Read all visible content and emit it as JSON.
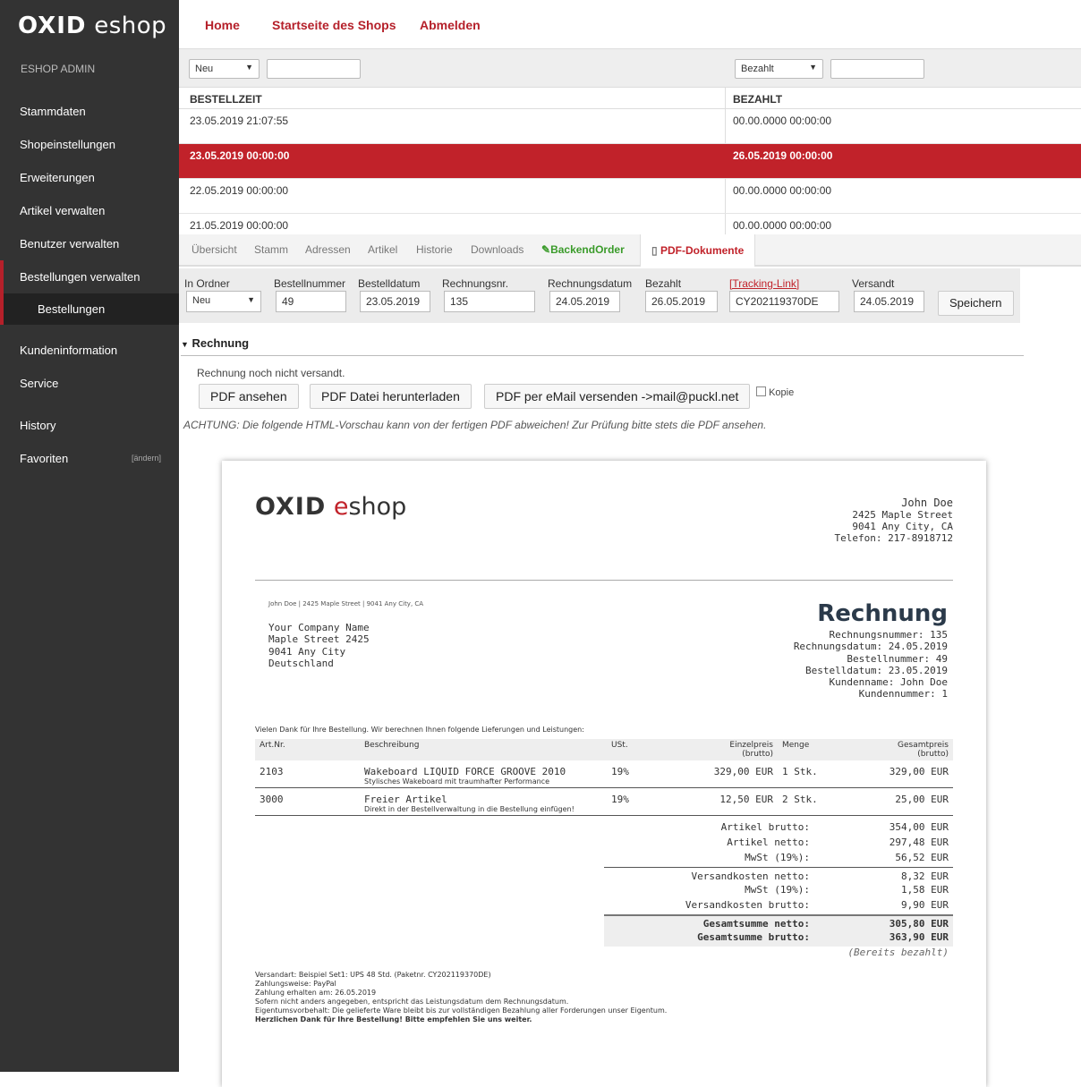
{
  "sidebar": {
    "logo_oxid": "OXID",
    "logo_eshop": "eshop",
    "header": "ESHOP ADMIN",
    "items": [
      "Stammdaten",
      "Shopeinstellungen",
      "Erweiterungen",
      "Artikel verwalten",
      "Benutzer verwalten",
      "Bestellungen verwalten"
    ],
    "sub_item": "Bestellungen",
    "items2": [
      "Kundeninformation",
      "Service"
    ],
    "history": "History",
    "favoriten": "Favoriten",
    "aendern": "[ändern]"
  },
  "topnav": {
    "home": "Home",
    "startseite": "Startseite des Shops",
    "abmelden": "Abmelden"
  },
  "list": {
    "filter_folder": "Neu",
    "filter_paid": "Bezahlt",
    "col_orderdate": "BESTELLZEIT",
    "col_paid": "BEZAHLT",
    "rows": [
      {
        "date": "23.05.2019 21:07:55",
        "paid": "00.00.0000 00:00:00"
      },
      {
        "date": "23.05.2019 00:00:00",
        "paid": "26.05.2019 00:00:00"
      },
      {
        "date": "22.05.2019 00:00:00",
        "paid": "00.00.0000 00:00:00"
      },
      {
        "date": "21.05.2019 00:00:00",
        "paid": "00.00.0000 00:00:00"
      }
    ]
  },
  "tabs": [
    "Übersicht",
    "Stamm",
    "Adressen",
    "Artikel",
    "Historie",
    "Downloads",
    "BackendOrder",
    "PDF-Dokumente"
  ],
  "form": {
    "labels": {
      "folder": "In Ordner",
      "ordernr": "Bestellnummer",
      "orderdate": "Bestelldatum",
      "invnr": "Rechnungsnr.",
      "invdate": "Rechnungsdatum",
      "paid": "Bezahlt",
      "tracking": "[Tracking-Link]",
      "sent": "Versandt"
    },
    "values": {
      "folder": "Neu",
      "ordernr": "49",
      "orderdate": "23.05.2019",
      "invnr": "135",
      "invdate": "24.05.2019",
      "paid": "26.05.2019",
      "tracking": "CY202119370DE",
      "sent": "24.05.2019"
    },
    "save": "Speichern"
  },
  "rechnung": {
    "title": "Rechnung",
    "status": "Rechnung noch nicht versandt.",
    "btn_view": "PDF ansehen",
    "btn_download": "PDF Datei herunterladen",
    "btn_mail": "PDF per eMail versenden ->mail@puckl.net",
    "copy": "Kopie",
    "warning": "ACHTUNG: Die folgende HTML-Vorschau kann von der fertigen PDF abweichen! Zur Prüfung bitte stets die PDF ansehen."
  },
  "pdf": {
    "logo_oxid": "OXID",
    "logo_e": "e",
    "logo_shop": "shop",
    "sender": [
      "John Doe",
      "2425 Maple Street",
      "9041 Any City, CA",
      "Telefon: 217-8918712"
    ],
    "sender_line": "John Doe | 2425 Maple Street | 9041 Any City, CA",
    "recipient": [
      "Your Company Name",
      "Maple Street 2425",
      "9041 Any City",
      "Deutschland"
    ],
    "title": "Rechnung",
    "meta": [
      "Rechnungsnummer:  135",
      "Rechnungsdatum:  24.05.2019",
      "Bestellnummer:  49",
      "Bestelldatum:  23.05.2019",
      "Kundenname:  John Doe",
      "Kundennummer:  1"
    ],
    "intro": "Vielen Dank für Ihre Bestellung. Wir berechnen Ihnen folgende Lieferungen und Leistungen:",
    "headers": {
      "artnr": "Art.Nr.",
      "desc": "Beschreibung",
      "vat": "USt.",
      "unit": "Einzelpreis",
      "unit2": "(brutto)",
      "qty": "Menge",
      "total": "Gesamtpreis",
      "total2": "(brutto)"
    },
    "items": [
      {
        "artnr": "2103",
        "title": "Wakeboard LIQUID FORCE GROOVE 2010",
        "sub": "Stylisches Wakeboard mit traumhafter Performance",
        "vat": "19%",
        "unit": "329,00 EUR",
        "qty": "1 Stk.",
        "total": "329,00 EUR"
      },
      {
        "artnr": "3000",
        "title": "Freier Artikel",
        "sub": "Direkt in der Bestellverwaltung in die Bestellung einfügen!",
        "vat": "19%",
        "unit": "12,50 EUR",
        "qty": "2 Stk.",
        "total": "25,00 EUR"
      }
    ],
    "totals": [
      {
        "label": "Artikel brutto:",
        "value": "354,00 EUR"
      },
      {
        "label": "Artikel netto:",
        "value": "297,48 EUR"
      },
      {
        "label": "MwSt (19%):",
        "value": "56,52 EUR"
      },
      {
        "label": "Versandkosten netto:",
        "value": "8,32 EUR"
      },
      {
        "label": "MwSt (19%):",
        "value": "1,58 EUR"
      },
      {
        "label": "Versandkosten brutto:",
        "value": "9,90 EUR"
      },
      {
        "label": "Gesamtsumme netto:",
        "value": "305,80 EUR"
      },
      {
        "label": "Gesamtsumme brutto:",
        "value": "363,90 EUR"
      }
    ],
    "paid_note": "(Bereits bezahlt)",
    "footer": [
      "Versandart: Beispiel Set1: UPS 48 Std.  (Paketnr. CY202119370DE)",
      "Zahlungsweise: PayPal",
      "Zahlung erhalten am: 26.05.2019",
      "Sofern nicht anders angegeben, entspricht das Leistungsdatum dem Rechnungsdatum.",
      "Eigentumsvorbehalt: Die gelieferte Ware bleibt bis zur vollständigen Bezahlung aller Forderungen unser Eigentum."
    ],
    "footer_bold": "Herzlichen Dank für Ihre Bestellung! Bitte empfehlen Sie uns weiter."
  }
}
